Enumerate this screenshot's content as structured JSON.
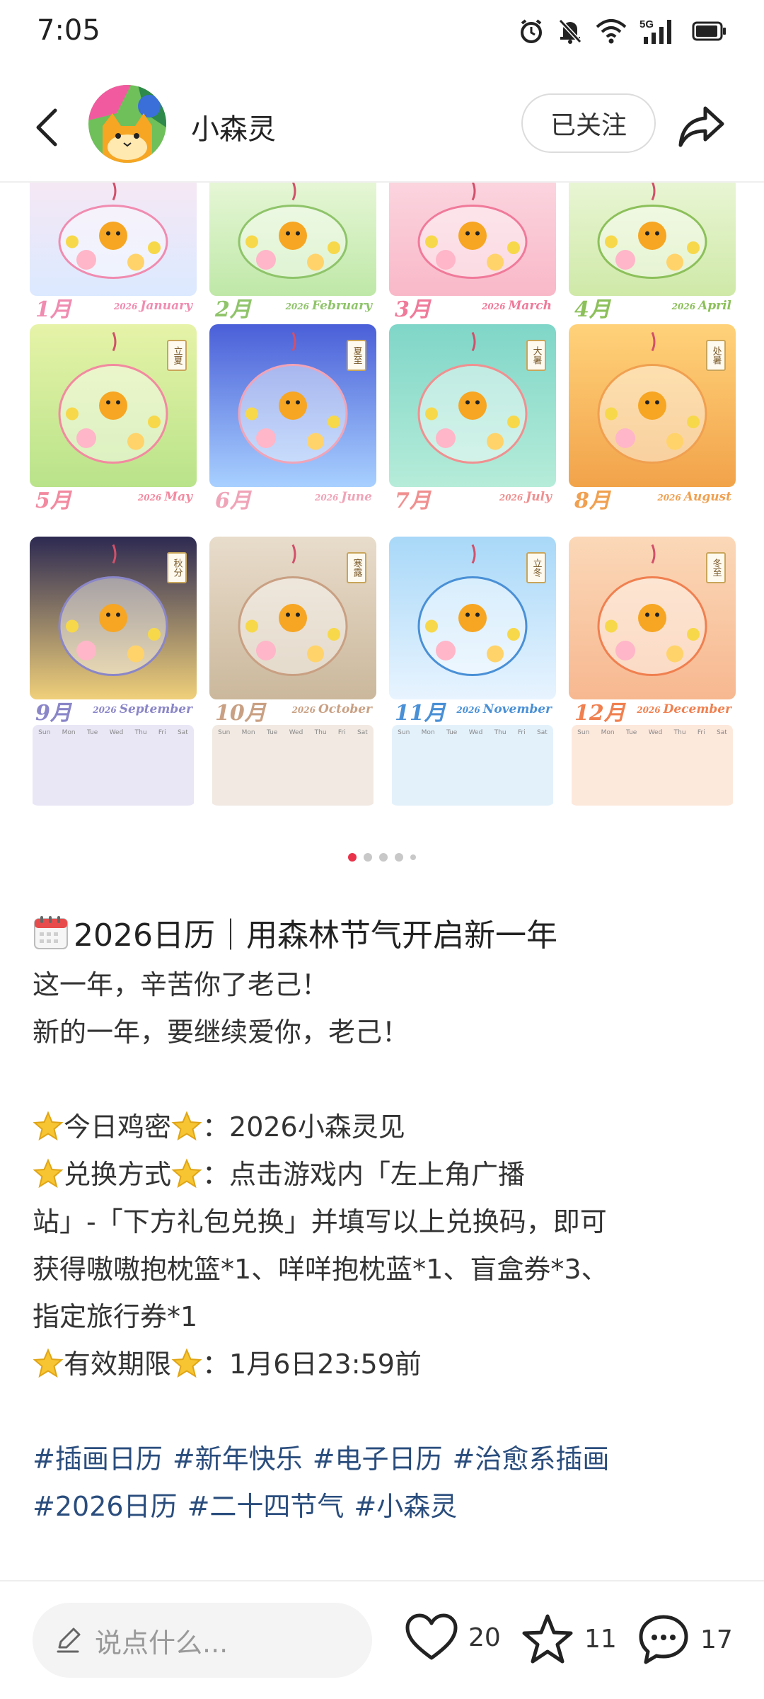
{
  "status_bar": {
    "time": "7:05",
    "icons": [
      "alarm-icon",
      "mute-icon",
      "wifi-icon",
      "5g-signal-icon",
      "battery-icon"
    ],
    "network": "5G"
  },
  "header": {
    "username": "小森灵",
    "follow_label": "已关注"
  },
  "carousel": {
    "year": "2026",
    "months": [
      {
        "cn": "1月",
        "en": "January",
        "color": "#f08cb0"
      },
      {
        "cn": "2月",
        "en": "February",
        "color": "#8fc46a"
      },
      {
        "cn": "3月",
        "en": "March",
        "color": "#f07a9a"
      },
      {
        "cn": "4月",
        "en": "April",
        "color": "#8cc05a"
      },
      {
        "cn": "5月",
        "en": "May",
        "color": "#f28aa0",
        "solar_term": "立夏"
      },
      {
        "cn": "6月",
        "en": "June",
        "color": "#f0a4b8",
        "solar_term": "夏至"
      },
      {
        "cn": "7月",
        "en": "July",
        "color": "#f09090",
        "solar_term": "大暑"
      },
      {
        "cn": "8月",
        "en": "August",
        "color": "#f0a050",
        "solar_term": "处暑"
      },
      {
        "cn": "9月",
        "en": "September",
        "color": "#8a86c8",
        "solar_term": "秋分"
      },
      {
        "cn": "10月",
        "en": "October",
        "color": "#c9a083",
        "solar_term": "寒露"
      },
      {
        "cn": "11月",
        "en": "November",
        "color": "#4a90d6",
        "solar_term": "立冬"
      },
      {
        "cn": "12月",
        "en": "December",
        "color": "#f08050",
        "solar_term": "冬至"
      }
    ],
    "weekdays": [
      "Sun",
      "Mon",
      "Tue",
      "Wed",
      "Thu",
      "Fri",
      "Sat"
    ],
    "page_count": 5,
    "active_page": 1
  },
  "article": {
    "title": "2026日历｜用森林节气开启新一年",
    "line1": "这一年，辛苦你了老己！",
    "line2": "新的一年，要继续爱你，老己！",
    "code_label": "今日鸡密",
    "code_value": "：2026小森灵见",
    "method_label": "兑换方式",
    "method_value_a": "：点击游戏内「左上角广播",
    "method_value_b": "站」-「下方礼包兑换」并填写以上兑换码，即可",
    "method_value_c": "获得嗷嗷抱枕篮*1、咩咩抱枕蓝*1、盲盒券*3、",
    "method_value_d": "指定旅行券*1",
    "expiry_label": "有效期限",
    "expiry_value": "：1月6日23:59前",
    "tags": [
      "#插画日历",
      "#新年快乐",
      "#电子日历",
      "#治愈系插画",
      "#2026日历",
      "#二十四节气",
      "#小森灵"
    ]
  },
  "bottom_bar": {
    "comment_placeholder": "说点什么...",
    "likes": "20",
    "stars": "11",
    "comments": "17"
  }
}
